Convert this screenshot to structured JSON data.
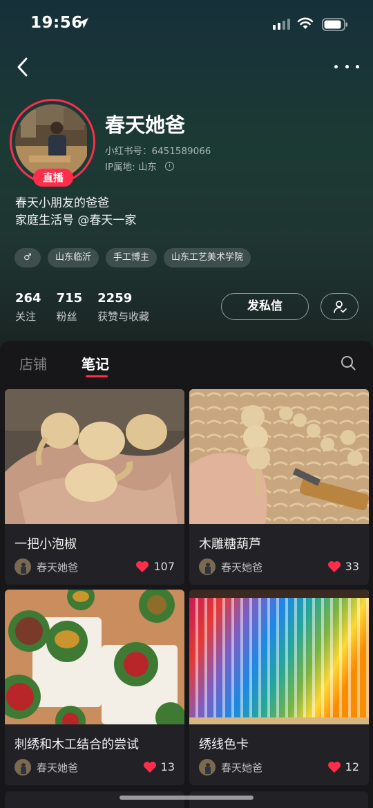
{
  "status_bar": {
    "time": "19:56"
  },
  "profile": {
    "nickname": "春天她爸",
    "id_label": "小红书号：6451589066",
    "ip_label": "IP属地: 山东",
    "live_badge": "直播",
    "bio_line1": "春天小朋友的爸爸",
    "bio_line2": "家庭生活号 @春天一家",
    "gender_icon": "♂",
    "tags": [
      "山东临沂",
      "手工博主",
      "山东工艺美术学院"
    ]
  },
  "stats": [
    {
      "value": "264",
      "label": "关注"
    },
    {
      "value": "715",
      "label": "粉丝"
    },
    {
      "value": "2259",
      "label": "获赞与收藏"
    }
  ],
  "actions": {
    "message_label": "发私信"
  },
  "tabs": {
    "shop": "店铺",
    "notes": "笔记"
  },
  "notes": [
    {
      "title": "一把小泡椒",
      "author": "春天她爸",
      "likes": "107"
    },
    {
      "title": "木雕糖葫芦",
      "author": "春天她爸",
      "likes": "33"
    },
    {
      "title": "刺绣和木工结合的尝试",
      "author": "春天她爸",
      "likes": "13"
    },
    {
      "title": "绣线色卡",
      "author": "春天她爸",
      "likes": "12"
    }
  ],
  "colors": {
    "accent": "#ff2d4c",
    "card_bg": "#222226",
    "panel_bg": "#17171a"
  }
}
